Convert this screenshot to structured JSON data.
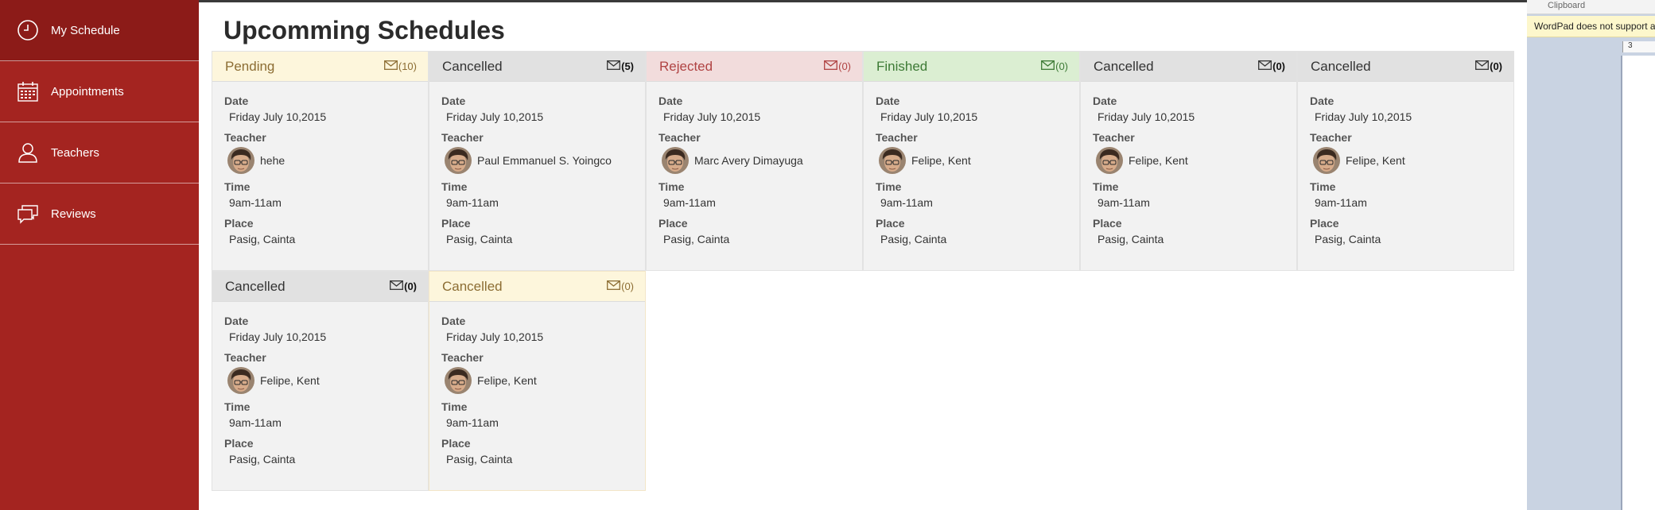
{
  "sidebar": {
    "items": [
      {
        "label": "My Schedule",
        "icon": "clock-icon",
        "active": true
      },
      {
        "label": "Appointments",
        "icon": "calendar-icon",
        "active": false
      },
      {
        "label": "Teachers",
        "icon": "person-icon",
        "active": false
      },
      {
        "label": "Reviews",
        "icon": "chat-bubbles-icon",
        "active": false
      }
    ]
  },
  "main": {
    "title": "Upcomming Schedules",
    "labels": {
      "date": "Date",
      "teacher": "Teacher",
      "time": "Time",
      "place": "Place"
    },
    "cards": [
      {
        "status": "Pending",
        "count": "(10)",
        "date": "Friday July 10,2015",
        "teacher": "hehe",
        "time": "9am-11am",
        "place": "Pasig, Cainta"
      },
      {
        "status": "Cancelled",
        "count": "(5)",
        "date": "Friday July 10,2015",
        "teacher": "Paul Emmanuel S. Yoingco",
        "time": "9am-11am",
        "place": "Pasig, Cainta"
      },
      {
        "status": "Rejected",
        "count": "(0)",
        "date": "Friday July 10,2015",
        "teacher": "Marc Avery Dimayuga",
        "time": "9am-11am",
        "place": "Pasig, Cainta"
      },
      {
        "status": "Finished",
        "count": "(0)",
        "date": "Friday July 10,2015",
        "teacher": "Felipe, Kent",
        "time": "9am-11am",
        "place": "Pasig, Cainta"
      },
      {
        "status": "Cancelled",
        "count": "(0)",
        "date": "Friday July 10,2015",
        "teacher": "Felipe, Kent",
        "time": "9am-11am",
        "place": "Pasig, Cainta"
      },
      {
        "status": "Cancelled",
        "count": "(0)",
        "date": "Friday July 10,2015",
        "teacher": "Felipe, Kent",
        "time": "9am-11am",
        "place": "Pasig, Cainta"
      },
      {
        "status": "Cancelled",
        "count": "(0)",
        "date": "Friday July 10,2015",
        "teacher": "Felipe, Kent",
        "time": "9am-11am",
        "place": "Pasig, Cainta"
      },
      {
        "status": "Cancelled",
        "count": "(0)",
        "date": "Friday July 10,2015",
        "teacher": "Felipe, Kent",
        "time": "9am-11am",
        "place": "Pasig, Cainta"
      }
    ]
  },
  "wordpad": {
    "clipboard": "Clipboard",
    "notice": "WordPad does not support a",
    "ruler_number": "3"
  },
  "colors": {
    "sidebar": "#a42420",
    "sidebar_active": "#8c1b18",
    "pending_head": "#fdf6dc",
    "rejected_head": "#f2dcdc",
    "finished_head": "#dbeed2",
    "cancelled_head": "#e1e1e1"
  }
}
